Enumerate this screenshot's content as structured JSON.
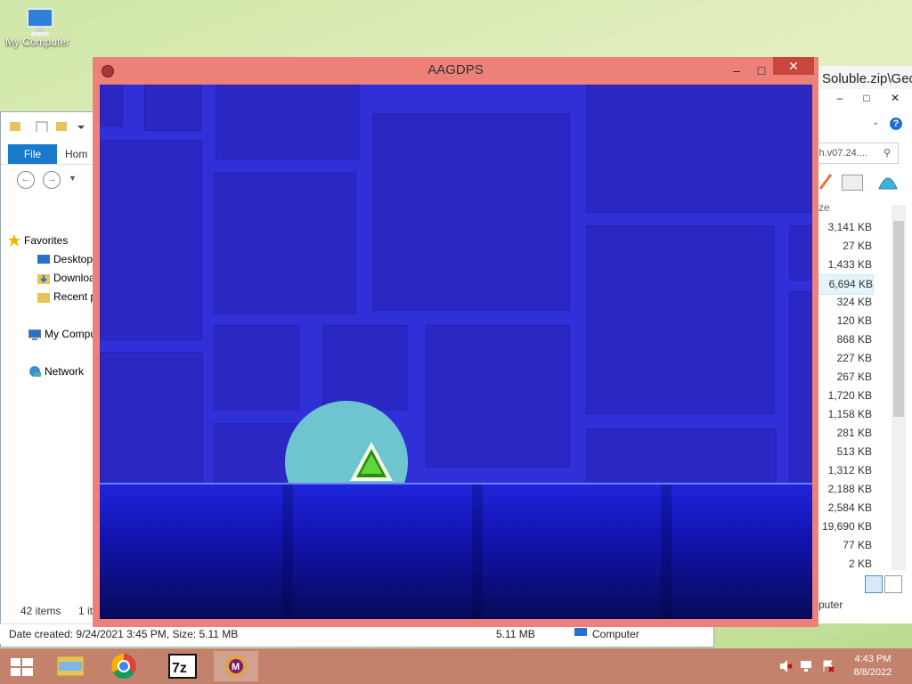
{
  "desktop": {
    "icon_label": "My Computer"
  },
  "explorer": {
    "tabs": {
      "file": "File",
      "home": "Hom"
    },
    "nav": [
      {
        "label": "Favorites",
        "icon": "star-icon"
      },
      {
        "label": "Desktop",
        "icon": "desktop-icon"
      },
      {
        "label": "Downloa",
        "icon": "downloads-icon"
      },
      {
        "label": "Recent p",
        "icon": "recent-places-icon"
      },
      {
        "label": "My Compu",
        "icon": "computer-icon"
      },
      {
        "label": "Network",
        "icon": "network-icon"
      }
    ],
    "items_count": "42 items",
    "items_selected": "1 it",
    "status": {
      "date": "Date created: 9/24/2021 3:45 PM, Size: 5.11 MB",
      "size": "5.11 MB",
      "location": "Computer"
    }
  },
  "explorer2": {
    "title": "Soluble.zip\\Geo",
    "search": "sh.v07.24....",
    "size_header": "ze",
    "sizes": [
      "3,141 KB",
      "27 KB",
      "1,433 KB",
      "6,694 KB",
      "324 KB",
      "120 KB",
      "868 KB",
      "227 KB",
      "267 KB",
      "1,720 KB",
      "1,158 KB",
      "281 KB",
      "513 KB",
      "1,312 KB",
      "2,188 KB",
      "2,584 KB",
      "19,690 KB",
      "77 KB",
      "2 KB"
    ],
    "status": "puter"
  },
  "game": {
    "title": "AAGDPS",
    "colors": {
      "bg": "#3030d8",
      "ground": "#1214b0",
      "orb": "#6ec5cf",
      "player": "#2e8a12"
    }
  },
  "taskbar": {
    "time": "4:43 PM",
    "date": "8/8/2022",
    "apps": [
      "start-icon",
      "file-explorer-icon",
      "chrome-icon",
      "7zip-icon",
      "game-icon"
    ]
  }
}
